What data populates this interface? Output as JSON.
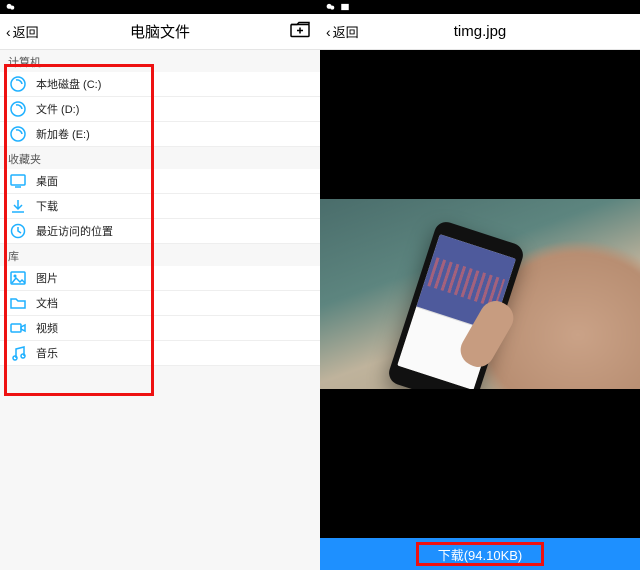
{
  "left": {
    "back": "返回",
    "title": "电脑文件",
    "sections": {
      "computer": {
        "head": "计算机",
        "drive_c": "本地磁盘 (C:)",
        "drive_d": "文件 (D:)",
        "drive_e": "新加卷 (E:)"
      },
      "fav": {
        "head": "收藏夹",
        "desktop": "桌面",
        "downloads": "下载",
        "recent": "最近访问的位置"
      },
      "lib": {
        "head": "库",
        "pictures": "图片",
        "docs": "文档",
        "video": "视频",
        "music": "音乐"
      }
    }
  },
  "right": {
    "back": "返回",
    "title": "timg.jpg",
    "download": "下载(94.10KB)"
  }
}
